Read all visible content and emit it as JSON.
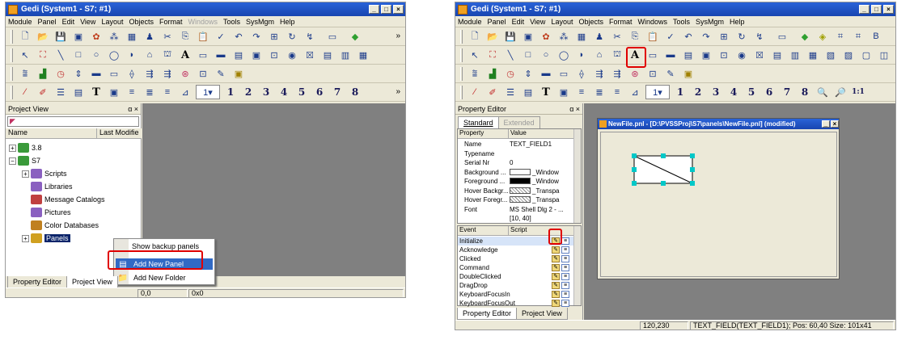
{
  "left": {
    "title": "Gedi (System1 - S7; #1)",
    "window_buttons": [
      "_",
      "□",
      "×"
    ],
    "menu": [
      "Module",
      "Panel",
      "Edit",
      "View",
      "Layout",
      "Objects",
      "Format",
      "Windows",
      "Tools",
      "SysMgm",
      "Help"
    ],
    "menu_disabled": [
      "Windows"
    ],
    "toolbar_more": "»",
    "toolbar4_text": [
      "T",
      "1",
      "2",
      "3",
      "4",
      "5",
      "6",
      "7",
      "8"
    ],
    "project_view": {
      "header": "Project View",
      "header_buttons": "ɑ ×",
      "col_name": "Name",
      "col_last": "Last Modifie",
      "tree": [
        {
          "label": "3.8",
          "indent": 0,
          "expander": "+"
        },
        {
          "label": "S7",
          "indent": 0,
          "expander": "−"
        },
        {
          "label": "Scripts",
          "indent": 1,
          "expander": "+"
        },
        {
          "label": "Libraries",
          "indent": 1,
          "expander": ""
        },
        {
          "label": "Message Catalogs",
          "indent": 1,
          "expander": ""
        },
        {
          "label": "Pictures",
          "indent": 1,
          "expander": ""
        },
        {
          "label": "Color Databases",
          "indent": 1,
          "expander": ""
        },
        {
          "label": "Panels",
          "indent": 1,
          "expander": "+",
          "selected": true
        }
      ]
    },
    "context_menu": [
      "Show backup panels",
      "Add New Panel",
      "Add New Folder"
    ],
    "tabs": [
      "Property Editor",
      "Project View"
    ],
    "status": [
      "0,0",
      "0x0"
    ]
  },
  "right": {
    "title": "Gedi (System1 - S7; #1)",
    "window_buttons": [
      "_",
      "□",
      "×"
    ],
    "menu": [
      "Module",
      "Panel",
      "Edit",
      "View",
      "Layout",
      "Objects",
      "Format",
      "Windows",
      "Tools",
      "SysMgm",
      "Help"
    ],
    "toolbar4_text": [
      "T",
      "1",
      "2",
      "3",
      "4",
      "5",
      "6",
      "7",
      "8",
      "1:1"
    ],
    "text_tool": "A",
    "property_editor": {
      "header": "Property Editor",
      "header_buttons": "ɑ ×",
      "tabs": [
        "Standard",
        "Extended"
      ],
      "col_property": "Property",
      "col_value": "Value",
      "rows": [
        {
          "name": "Name",
          "value": "TEXT_FIELD1"
        },
        {
          "name": "Typename",
          "value": ""
        },
        {
          "name": "Serial Nr",
          "value": "0"
        },
        {
          "name": "Background ...",
          "value": "_Window"
        },
        {
          "name": "Foreground ...",
          "value": "_Window"
        },
        {
          "name": "Hover Backgr...",
          "value": "_Transpa"
        },
        {
          "name": "Hover Foregr...",
          "value": "_Transpa"
        },
        {
          "name": "Font",
          "value": "MS Shell Dlg 2 - ..."
        },
        {
          "name": "",
          "value": "[10, 40]"
        }
      ],
      "col_event": "Event",
      "col_script": "Script",
      "events": [
        "Initialize",
        "Acknowledge",
        "Clicked",
        "Command",
        "DoubleClicked",
        "DragDrop",
        "KeyboardFocusIn",
        "KeyboardFocusOut"
      ]
    },
    "panel_window": {
      "title": "NewFile.pnl - [D:\\PVSSProj\\S7\\panels\\NewFile.pnl] (modified)"
    },
    "tabs": [
      "Property Editor",
      "Project View"
    ],
    "status": [
      "120,230",
      "TEXT_FIELD(TEXT_FIELD1); Pos: 60,40 Size: 101x41"
    ]
  }
}
